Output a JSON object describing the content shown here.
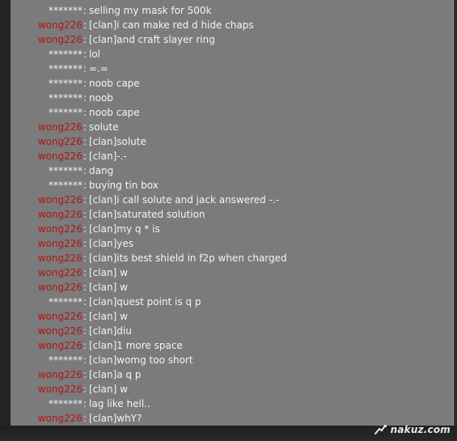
{
  "watermark": {
    "text": "nakuz.com"
  },
  "chat": {
    "messages": [
      {
        "sender": "*******",
        "color": "white",
        "text": "selling my mask for 500k"
      },
      {
        "sender": "wong226",
        "color": "red",
        "text": "[clan]i can make red d hide chaps"
      },
      {
        "sender": "wong226",
        "color": "red",
        "text": "[clan]and craft slayer ring"
      },
      {
        "sender": "*******",
        "color": "white",
        "text": "lol"
      },
      {
        "sender": "*******",
        "color": "white",
        "text": "=.="
      },
      {
        "sender": "*******",
        "color": "white",
        "text": "noob cape"
      },
      {
        "sender": "*******",
        "color": "white",
        "text": "noob"
      },
      {
        "sender": "*******",
        "color": "white",
        "text": "noob cape"
      },
      {
        "sender": "wong226",
        "color": "red",
        "text": "solute"
      },
      {
        "sender": "wong226",
        "color": "red",
        "text": "[clan]solute"
      },
      {
        "sender": "wong226",
        "color": "red",
        "text": "[clan]-.-"
      },
      {
        "sender": "*******",
        "color": "white",
        "text": "dang"
      },
      {
        "sender": "*******",
        "color": "white",
        "text": "buying tin box"
      },
      {
        "sender": "wong226",
        "color": "red",
        "text": "[clan]i call solute and jack answered -.-"
      },
      {
        "sender": "wong226",
        "color": "red",
        "text": "[clan]saturated solution"
      },
      {
        "sender": "wong226",
        "color": "red",
        "text": "[clan]my q * is"
      },
      {
        "sender": "wong226",
        "color": "red",
        "text": "[clan]yes"
      },
      {
        "sender": "wong226",
        "color": "red",
        "text": "[clan]its best shield in f2p when charged"
      },
      {
        "sender": "wong226",
        "color": "red",
        "text": "[clan] w"
      },
      {
        "sender": "wong226",
        "color": "red",
        "text": "[clan] w"
      },
      {
        "sender": "*******",
        "color": "white",
        "text": "[clan]quest point is q p"
      },
      {
        "sender": "wong226",
        "color": "red",
        "text": "[clan] w"
      },
      {
        "sender": "wong226",
        "color": "red",
        "text": "[clan]diu"
      },
      {
        "sender": "wong226",
        "color": "red",
        "text": "[clan]1 more space"
      },
      {
        "sender": "*******",
        "color": "white",
        "text": "[clan]womg too short"
      },
      {
        "sender": "wong226",
        "color": "red",
        "text": "[clan]a q p"
      },
      {
        "sender": "wong226",
        "color": "red",
        "text": "[clan] w"
      },
      {
        "sender": "*******",
        "color": "white",
        "text": "lag like hell.."
      },
      {
        "sender": "wong226",
        "color": "red",
        "text": "[clan]whY?"
      }
    ]
  }
}
